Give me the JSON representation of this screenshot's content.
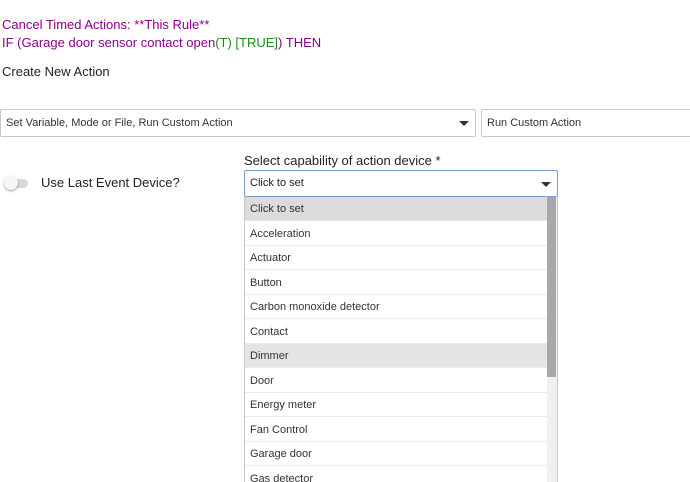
{
  "rule": {
    "line1": "Cancel Timed Actions: **This Rule**",
    "line2_prefix": "IF (Garage door sensor contact open",
    "line2_t": "(T)",
    "line2_space": " ",
    "line2_true": "[TRUE]",
    "line2_suffix": ") THEN"
  },
  "section_heading": "Create New Action",
  "action_type_select": {
    "value": "Set Variable, Mode or File, Run Custom Action"
  },
  "custom_action_select": {
    "value": "Run Custom Action"
  },
  "use_last_event_device": {
    "label": "Use Last Event Device?",
    "checked": false
  },
  "capability": {
    "label": "Select capability of action device *",
    "value": "Click to set",
    "options": [
      "Click to set",
      "Acceleration",
      "Actuator",
      "Button",
      "Carbon monoxide detector",
      "Contact",
      "Dimmer",
      "Door",
      "Energy meter",
      "Fan Control",
      "Garage door",
      "Gas detector"
    ]
  },
  "colors": {
    "rule_text": "#8b008b",
    "rule_true": "#1a8c1a",
    "selected_option_bg": "#dcdcdc",
    "focus_border": "#7f9bd3"
  },
  "icons": {
    "dropdown": "chevron-down-icon"
  }
}
